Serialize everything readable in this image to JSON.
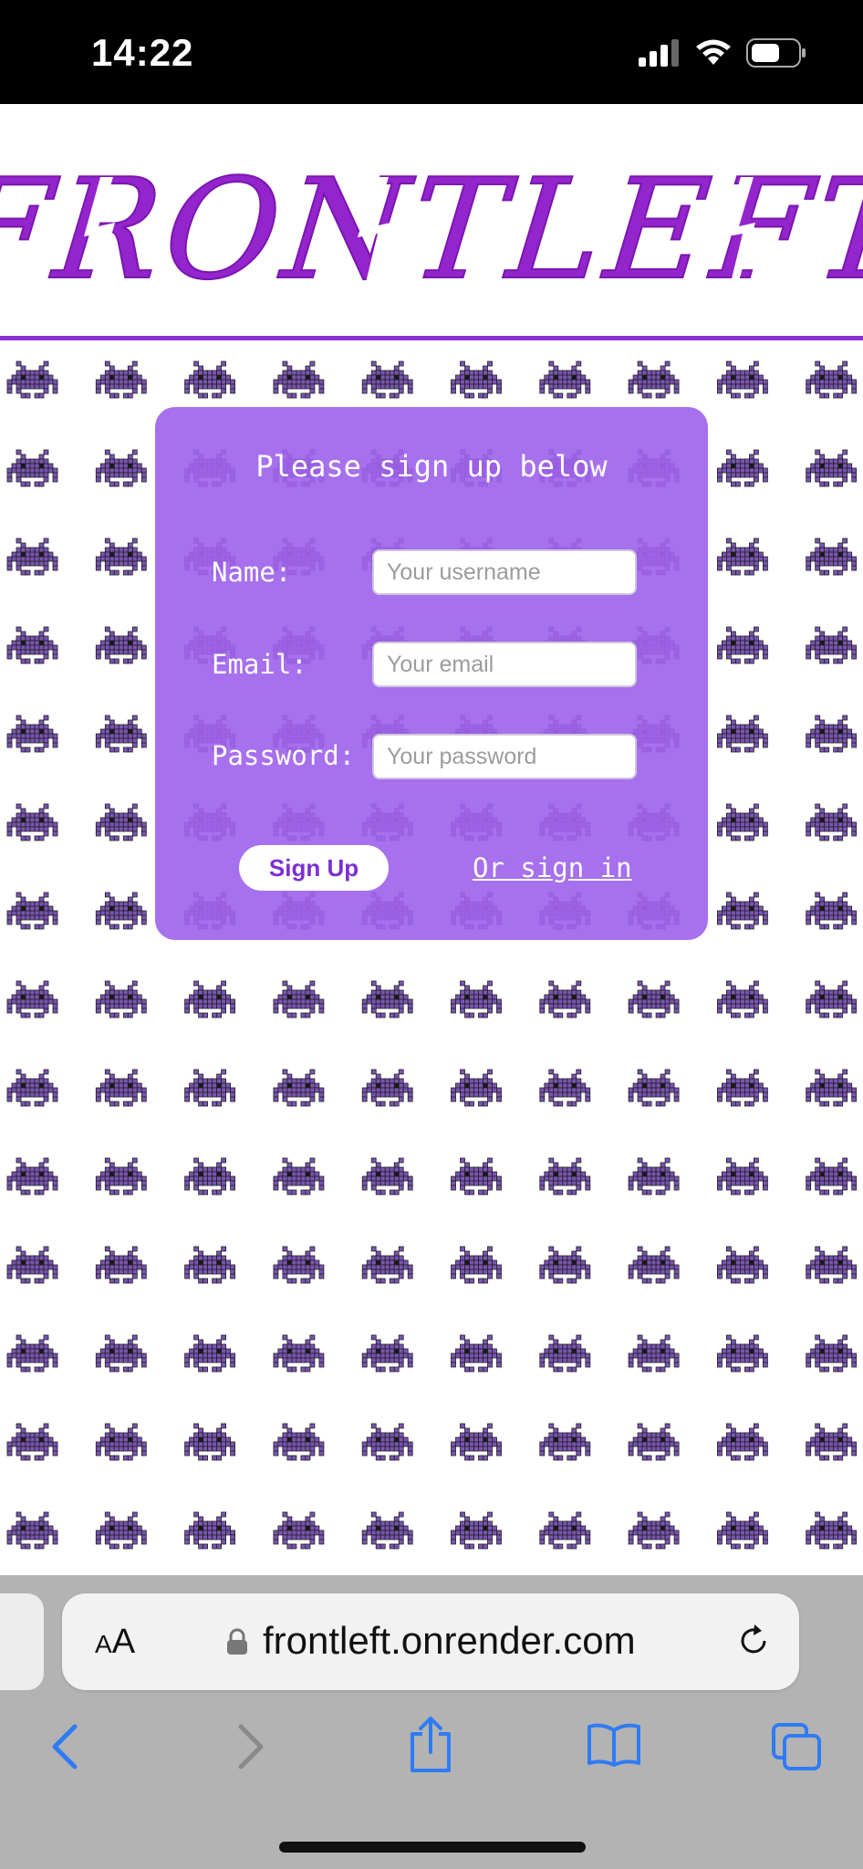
{
  "status_bar": {
    "time": "14:22",
    "icons": [
      "cellular-signal-icon",
      "wifi-icon",
      "battery-icon"
    ]
  },
  "header": {
    "logo_text": "FRONTLEFT",
    "accent_color": "#8f2fd2"
  },
  "background": {
    "pattern_icon": "space-invader-icon",
    "pattern_color": "#7a54b4"
  },
  "signup_form": {
    "title": "Please sign up below",
    "fields": [
      {
        "label": "Name:",
        "placeholder": "Your username",
        "value": ""
      },
      {
        "label": "Email:",
        "placeholder": "Your email",
        "value": ""
      },
      {
        "label": "Password:",
        "placeholder": "Your password",
        "value": ""
      }
    ],
    "submit_label": "Sign Up",
    "signin_link": "Or sign in",
    "card_color": "#a064eb"
  },
  "browser": {
    "text_size_small": "A",
    "text_size_big": "A",
    "url": "frontleft.onrender.com",
    "toolbar_icons": [
      "back-icon",
      "forward-icon",
      "share-icon",
      "bookmarks-icon",
      "tabs-icon"
    ],
    "accent_color": "#2f7bf5"
  }
}
